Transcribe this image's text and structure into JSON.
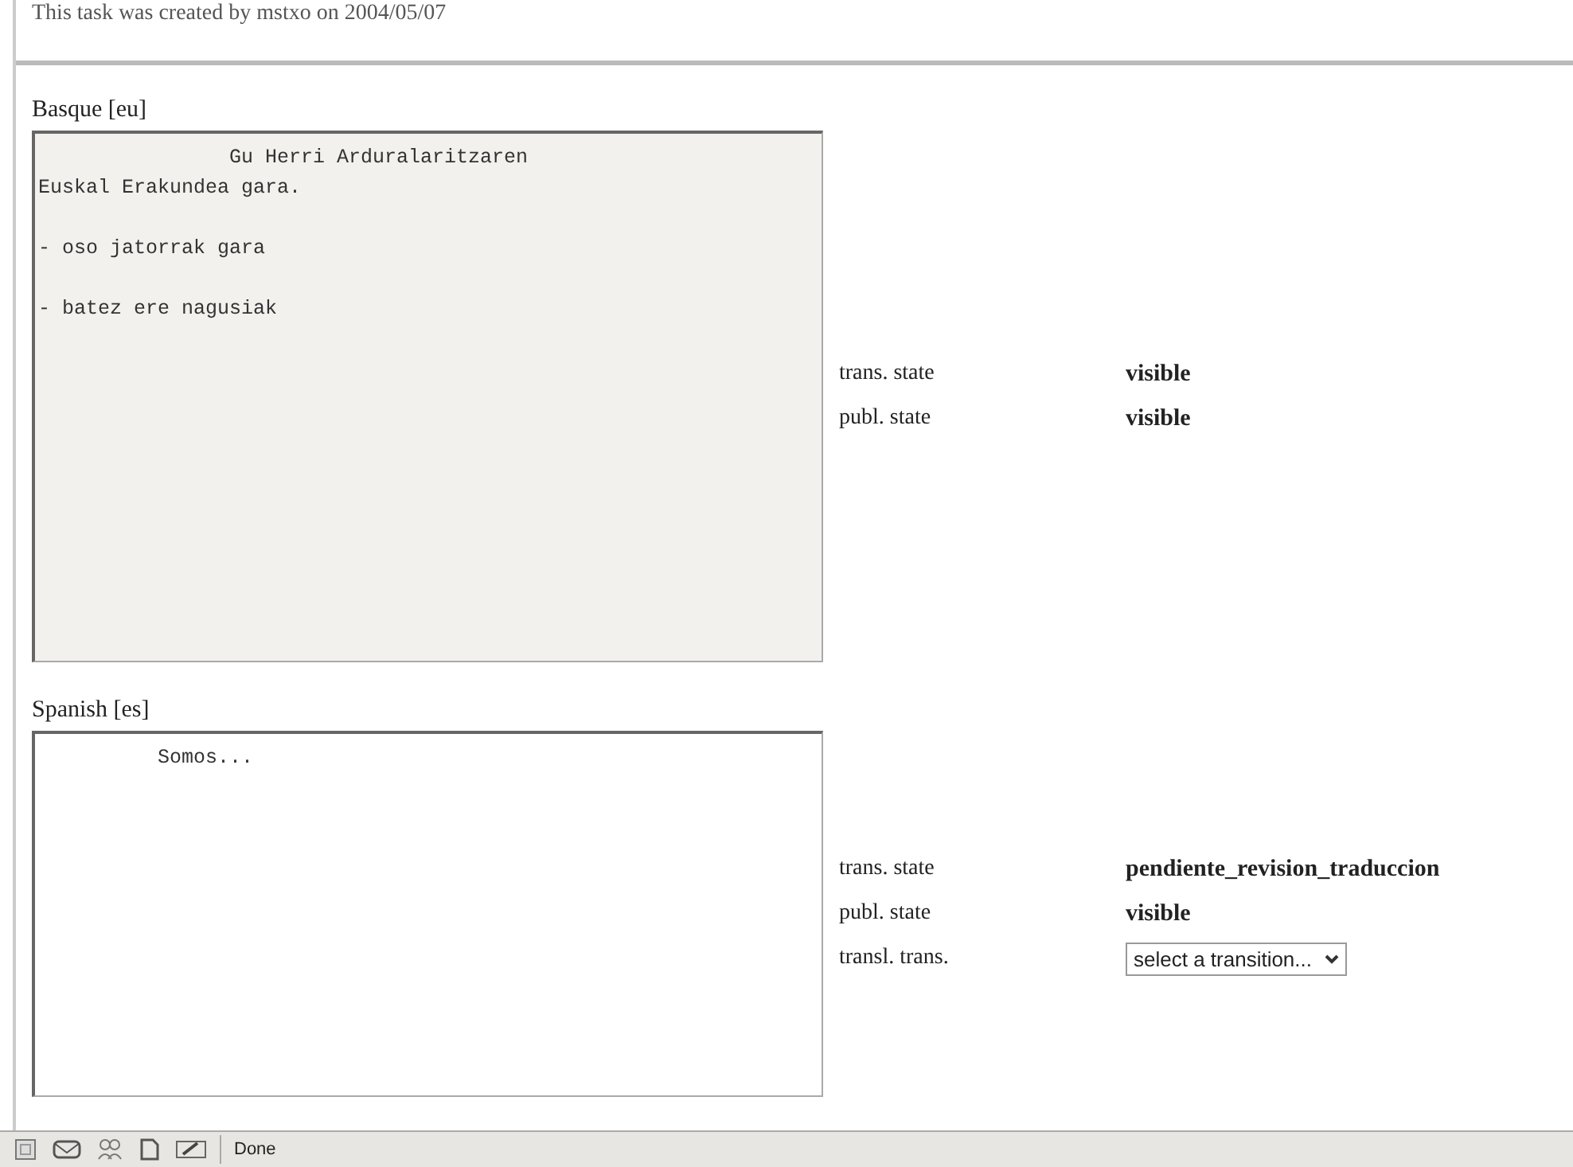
{
  "header": {
    "text": "This task was created by mstxo on 2004/05/07"
  },
  "sections": [
    {
      "language": "Basque [eu]",
      "disabled": true,
      "text": "                Gu Herri Arduralaritzaren\nEuskal Erakundea gara.\n\n- oso jatorrak gara\n\n- batez ere nagusiak",
      "properties": [
        {
          "kind": "text",
          "label": "trans. state",
          "value": "visible"
        },
        {
          "kind": "text",
          "label": "publ. state",
          "value": "visible"
        }
      ]
    },
    {
      "language": "Spanish [es]",
      "disabled": false,
      "text": "          Somos...",
      "properties": [
        {
          "kind": "text",
          "label": "trans. state",
          "value": "pendiente_revision_traduccion"
        },
        {
          "kind": "text",
          "label": "publ. state",
          "value": "visible"
        },
        {
          "kind": "select",
          "label": "transl. trans.",
          "value": "select a transition..."
        }
      ]
    }
  ],
  "status_bar": {
    "text": "Done"
  }
}
